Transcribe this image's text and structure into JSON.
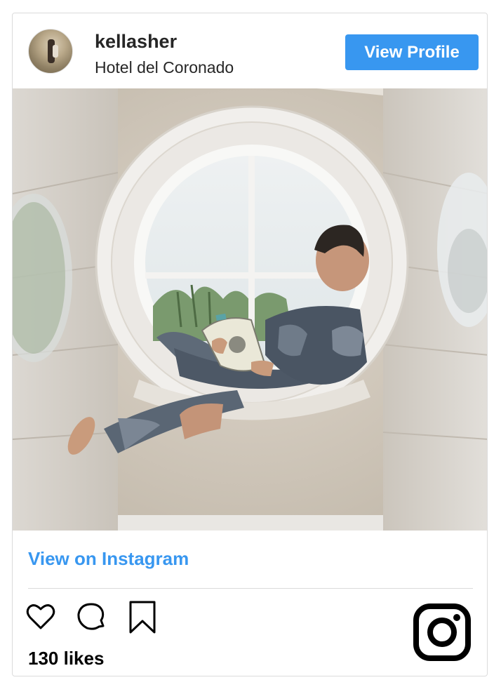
{
  "header": {
    "username": "kellasher",
    "location": "Hotel del Coronado",
    "view_profile_label": "View Profile"
  },
  "post": {
    "image_alt": "Boy in camouflage pajamas reading a book in a round window seat",
    "view_on_instagram_label": "View on Instagram",
    "likes_text": "130 likes"
  },
  "icons": {
    "like": "heart-icon",
    "comment": "comment-icon",
    "save": "bookmark-icon",
    "brand": "instagram-logo-icon"
  },
  "colors": {
    "accent": "#3897f0",
    "text": "#262626",
    "border": "#dbdbdb"
  }
}
